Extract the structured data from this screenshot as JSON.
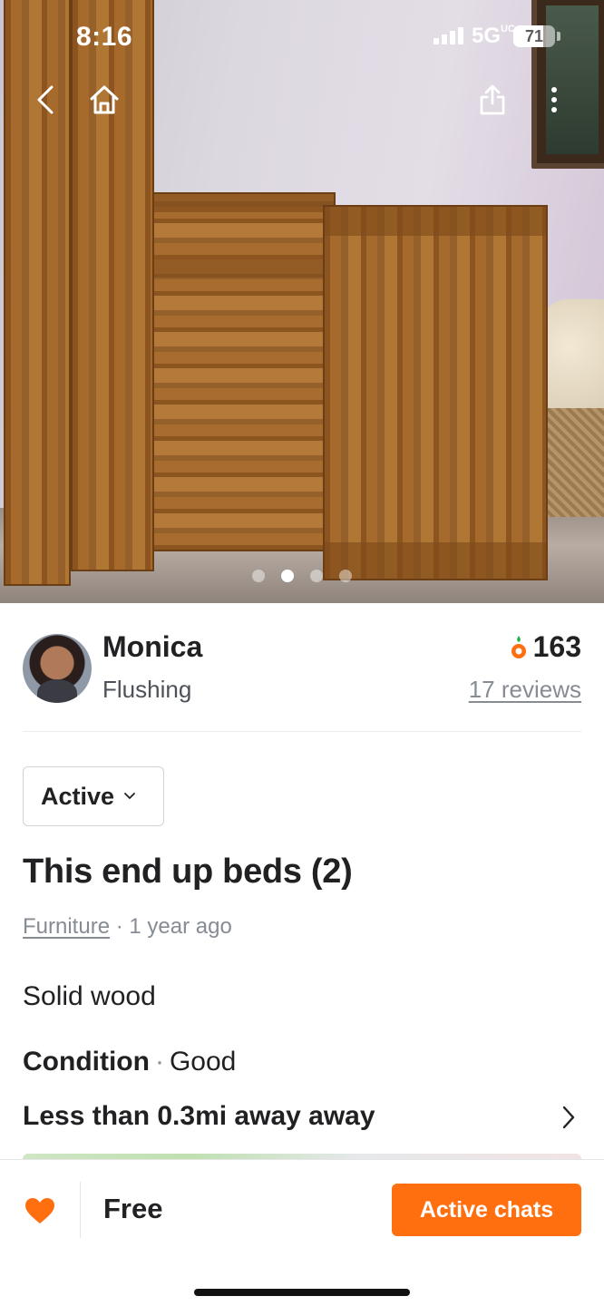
{
  "status_bar": {
    "time": "8:16",
    "network": "5G",
    "network_suffix": "UC",
    "battery": "71",
    "battery_level": 0.71
  },
  "nav": {
    "back_icon": "chevron-left-icon",
    "home_icon": "home-icon",
    "share_icon": "share-icon",
    "more_icon": "more-vertical-icon"
  },
  "gallery": {
    "image_count": 4,
    "current_index": 1
  },
  "seller": {
    "name": "Monica",
    "location": "Flushing",
    "manner_temp": "163",
    "reviews": "17 reviews",
    "temp_icon": "carrot-icon"
  },
  "listing": {
    "status": "Active",
    "title": "This end up beds (2)",
    "category": "Furniture",
    "meta_sep": "·",
    "posted": "1 year ago",
    "description": "Solid wood",
    "condition_label": "Condition",
    "condition_sep": "·",
    "condition_value": "Good",
    "distance": "Less than 0.3mi away away"
  },
  "bottom_bar": {
    "price": "Free",
    "chat_button": "Active chats",
    "like_icon": "heart-icon"
  },
  "colors": {
    "accent": "#ff6f0f",
    "text": "#212124",
    "muted": "#868b94"
  }
}
